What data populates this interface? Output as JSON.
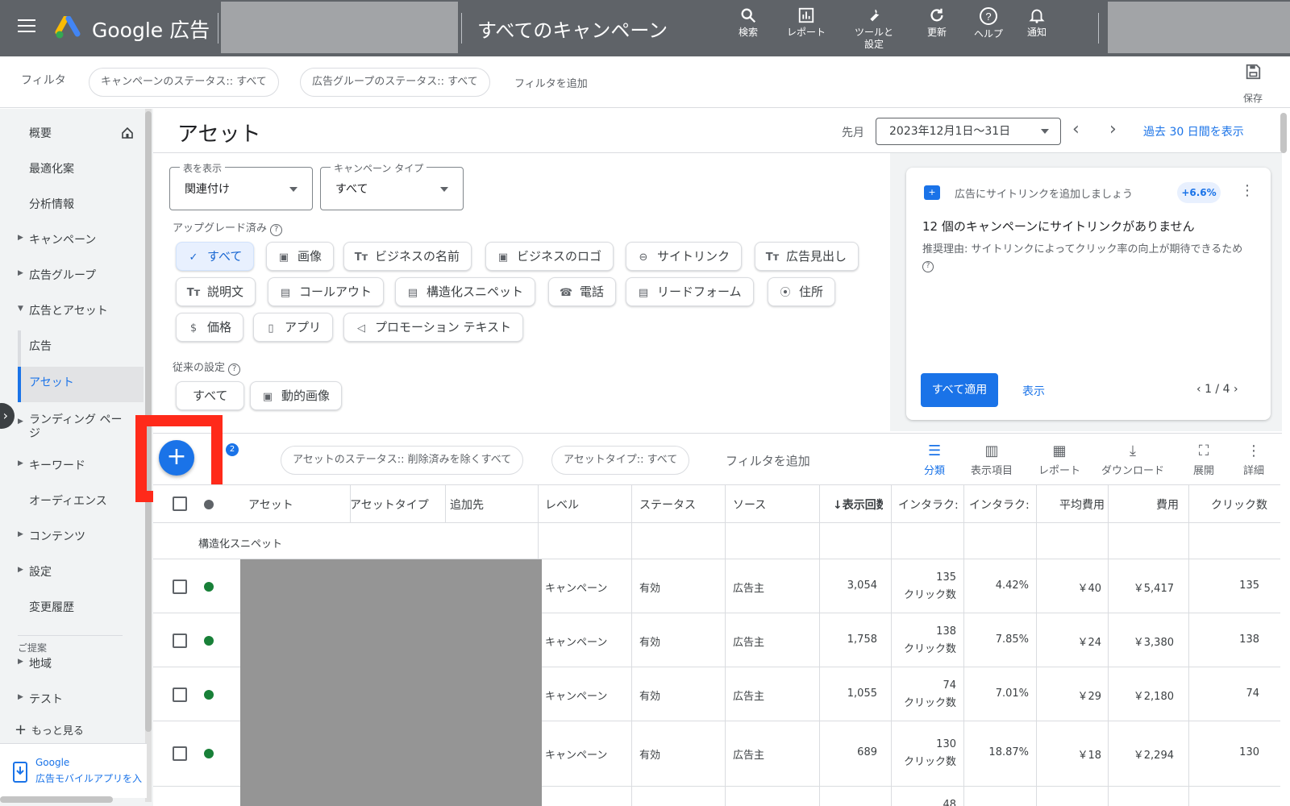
{
  "topbar": {
    "brand": "Google 広告",
    "heading": "すべてのキャンペーン",
    "tools": [
      {
        "icon": "search-icon",
        "label": "検索"
      },
      {
        "icon": "report-icon",
        "label": "レポート"
      },
      {
        "icon": "wrench-icon",
        "label": "ツールと\n設定"
      },
      {
        "icon": "refresh-icon",
        "label": "更新"
      },
      {
        "icon": "help-icon",
        "label": "ヘルプ"
      },
      {
        "icon": "bell-icon",
        "label": "通知"
      }
    ]
  },
  "filterbar": {
    "label": "フィルタ",
    "pills": [
      "キャンペーンのステータス:: すべて",
      "広告グループのステータス:: すべて"
    ],
    "add_filter": "フィルタを追加",
    "save": "保存"
  },
  "sidebar": {
    "items": [
      {
        "label": "概要",
        "arrow": false
      },
      {
        "label": "最適化案",
        "arrow": false
      },
      {
        "label": "分析情報",
        "arrow": false
      },
      {
        "label": "キャンペーン",
        "arrow": true
      },
      {
        "label": "広告グループ",
        "arrow": true
      },
      {
        "label": "広告とアセット",
        "arrow": "down"
      },
      {
        "label": "広告",
        "arrow": false
      },
      {
        "label": "アセット",
        "arrow": false,
        "active": true
      },
      {
        "label": "ランディング ページ",
        "arrow": true
      },
      {
        "label": "キーワード",
        "arrow": true
      },
      {
        "label": "オーディエンス",
        "arrow": false
      },
      {
        "label": "コンテンツ",
        "arrow": true
      },
      {
        "label": "設定",
        "arrow": true
      },
      {
        "label": "変更履歴",
        "arrow": false
      }
    ],
    "suggest_label": "ご提案",
    "suggest_items": [
      {
        "label": "地域",
        "arrow": true
      },
      {
        "label": "テスト",
        "arrow": true
      }
    ],
    "more": "もっと見る",
    "mobile_app_line1": "Google",
    "mobile_app_line2": "広告モバイルアプリを入"
  },
  "main": {
    "title": "アセット",
    "period_label": "先月",
    "date_range": "2023年12月1日～31日",
    "past30": "過去 30 日間を表示",
    "view_select": {
      "label": "表を表示",
      "value": "関連付け"
    },
    "campaign_type_select": {
      "label": "キャンペーン タイプ",
      "value": "すべて"
    },
    "upgraded_label": "アップグレード済み",
    "upgraded_chips": [
      {
        "icon": "check-icon",
        "label": "すべて",
        "selected": true
      },
      {
        "icon": "image-icon",
        "label": "画像"
      },
      {
        "icon": "text-icon",
        "label": "ビジネスの名前"
      },
      {
        "icon": "image-icon",
        "label": "ビジネスのロゴ"
      },
      {
        "icon": "link-icon",
        "label": "サイトリンク"
      },
      {
        "icon": "text-icon",
        "label": "広告見出し"
      },
      {
        "icon": "text-icon",
        "label": "説明文"
      },
      {
        "icon": "doc-icon",
        "label": "コールアウト"
      },
      {
        "icon": "doc-icon",
        "label": "構造化スニペット"
      },
      {
        "icon": "phone-icon",
        "label": "電話"
      },
      {
        "icon": "form-icon",
        "label": "リードフォーム"
      },
      {
        "icon": "pin-icon",
        "label": "住所"
      },
      {
        "icon": "price-icon",
        "label": "価格"
      },
      {
        "icon": "mobile-icon",
        "label": "アプリ"
      },
      {
        "icon": "megaphone-icon",
        "label": "プロモーション テキスト"
      }
    ],
    "legacy_label": "従来の設定",
    "legacy_chips": [
      {
        "icon": "",
        "label": "すべて"
      },
      {
        "icon": "image-icon",
        "label": "動的画像"
      }
    ]
  },
  "recommendation": {
    "head": "広告にサイトリンクを追加しましょう",
    "badge": "+6.6%",
    "title": "12 個のキャンペーンにサイトリンクがありません",
    "body": "推奨理由: サイトリンクによってクリック率の向上が期待できるため",
    "apply": "すべて適用",
    "show": "表示",
    "pager": "1 / 4"
  },
  "table_toolbar": {
    "filter_count": "2",
    "pills": [
      "アセットのステータス:: 削除済みを除くすべて",
      "アセットタイプ:: すべて"
    ],
    "add_filter": "フィルタを追加",
    "tools": [
      {
        "icon": "segment-icon",
        "label": "分類",
        "active": true
      },
      {
        "icon": "columns-icon",
        "label": "表示項目"
      },
      {
        "icon": "report-icon",
        "label": "レポート"
      },
      {
        "icon": "download-icon",
        "label": "ダウンロード"
      },
      {
        "icon": "expand-icon",
        "label": "展開"
      },
      {
        "icon": "more-icon",
        "label": "詳細"
      }
    ]
  },
  "table": {
    "columns": [
      "アセット",
      "アセットタイプ",
      "追加先",
      "レベル",
      "ステータス",
      "ソース",
      "表示回数",
      "インタラク:",
      "インタラク:",
      "平均費用",
      "費用",
      "クリック数"
    ],
    "group_label": "構造化スニペット",
    "rows": [
      {
        "level": "キャンペーン",
        "status": "有効",
        "source": "広告主",
        "impressions": "3,054",
        "interactions": "135",
        "interaction_unit": "クリック数",
        "interaction_rate": "4.42%",
        "avg_cost": "￥40",
        "cost": "￥5,417",
        "clicks": "135"
      },
      {
        "level": "キャンペーン",
        "status": "有効",
        "source": "広告主",
        "impressions": "1,758",
        "interactions": "138",
        "interaction_unit": "クリック数",
        "interaction_rate": "7.85%",
        "avg_cost": "￥24",
        "cost": "￥3,380",
        "clicks": "138"
      },
      {
        "level": "キャンペーン",
        "status": "有効",
        "source": "広告主",
        "impressions": "1,055",
        "interactions": "74",
        "interaction_unit": "クリック数",
        "interaction_rate": "7.01%",
        "avg_cost": "￥29",
        "cost": "￥2,180",
        "clicks": "74"
      },
      {
        "level": "キャンペーン",
        "status": "有効",
        "source": "広告主",
        "impressions": "689",
        "interactions": "130",
        "interaction_unit": "クリック数",
        "interaction_rate": "18.87%",
        "avg_cost": "￥18",
        "cost": "￥2,294",
        "clicks": "130"
      }
    ],
    "partial_row_interactions": "48"
  },
  "colors": {
    "accent": "#1a73e8",
    "topbar": "#5f6368",
    "highlight": "#ff2a1a",
    "status_ok": "#188038"
  }
}
